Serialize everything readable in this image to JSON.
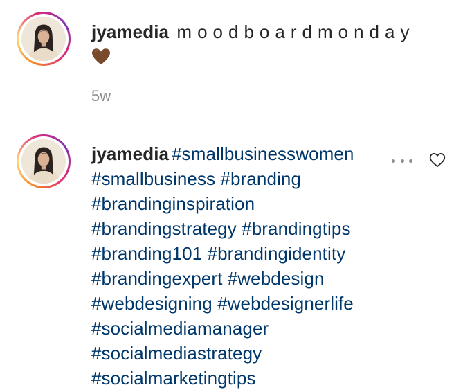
{
  "comments": [
    {
      "username": "jyamedia",
      "text": "moodboardmonday",
      "emoji": "brown-heart",
      "timestamp": "5w"
    },
    {
      "username": "jyamedia",
      "hashtag_lines": [
        [
          "#smallbusinesswomen"
        ],
        [
          "#smallbusiness",
          "#branding"
        ],
        [
          "#brandinginspiration"
        ],
        [
          "#brandingstrategy",
          "#brandingtips"
        ],
        [
          "#branding101",
          "#brandingidentity"
        ],
        [
          "#brandingexpert",
          "#webdesign"
        ],
        [
          "#webdesigning",
          "#webdesignerlife"
        ],
        [
          "#socialmediamanager"
        ],
        [
          "#socialmediastrategy"
        ],
        [
          "#socialmarketingtips"
        ]
      ]
    }
  ],
  "icons": {
    "more": "more-options-icon",
    "like": "heart-outline-icon"
  },
  "colors": {
    "hashtag": "#00376b",
    "text": "#262626",
    "muted": "#8e8e8e",
    "emoji_heart": "#7a4a2c"
  }
}
